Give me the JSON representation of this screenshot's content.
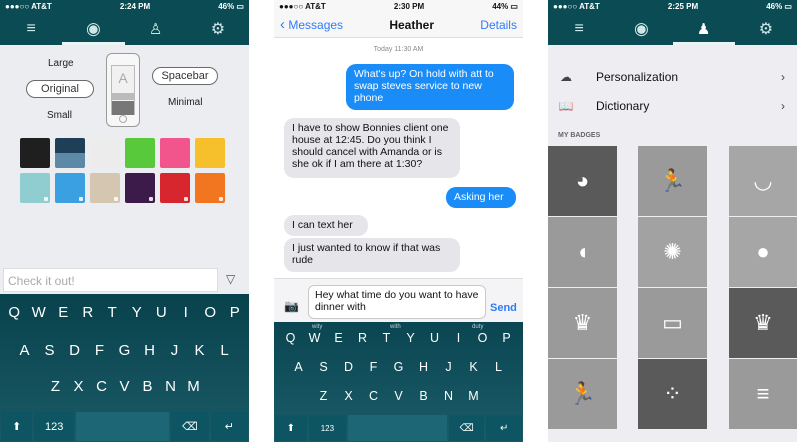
{
  "phone1": {
    "status": {
      "carrier": "●●●○○ AT&T ",
      "time": "2:24 PM",
      "battery": "46% ▭"
    },
    "tabs": [
      {
        "icon": "menu-icon",
        "glyph": "≡"
      },
      {
        "icon": "theme-icon",
        "glyph": "◉"
      },
      {
        "icon": "person-icon",
        "glyph": "♙"
      },
      {
        "icon": "gear-icon",
        "glyph": "⚙"
      }
    ],
    "size_options": {
      "large": "Large",
      "original": "Original",
      "small": "Small",
      "spacebar": "Spacebar",
      "minimal": "Minimal",
      "preview_letter": "A"
    },
    "swatches": [
      {
        "color": "#1f1f1f",
        "locked": false
      },
      {
        "color": "#1e3f57",
        "locked": false
      },
      {
        "color": "#ececec",
        "locked": false
      },
      {
        "color": "#58c93a",
        "locked": false
      },
      {
        "color": "#f2548c",
        "locked": false
      },
      {
        "color": "#f6c02d",
        "locked": false
      },
      {
        "color": "#8fcdd1",
        "locked": true
      },
      {
        "color": "#3aa0e2",
        "locked": true
      },
      {
        "color": "#d4c6b1",
        "locked": true
      },
      {
        "color": "#3c1a4a",
        "locked": true
      },
      {
        "color": "#d7262e",
        "locked": true
      },
      {
        "color": "#f2761f",
        "locked": true
      }
    ],
    "test_input_placeholder": "Check it out!",
    "keyboard": {
      "row1": [
        "Q",
        "W",
        "E",
        "R",
        "T",
        "Y",
        "U",
        "I",
        "O",
        "P"
      ],
      "row2": [
        "A",
        "S",
        "D",
        "F",
        "G",
        "H",
        "J",
        "K",
        "L"
      ],
      "row3": [
        "Z",
        "X",
        "C",
        "V",
        "B",
        "N",
        "M"
      ],
      "shift": "⬆",
      "numbers": "123",
      "delete": "⌫",
      "return": "↵"
    }
  },
  "phone2": {
    "status": {
      "carrier": "●●●○○ AT&T ",
      "time": "2:30 PM",
      "battery": "44% ▭"
    },
    "nav": {
      "back": "Messages",
      "title": "Heather",
      "details": "Details"
    },
    "timestamp": "Today 11:30 AM",
    "messages": [
      {
        "from": "me",
        "text": "What's up? On hold with att to swap steves service to new phone"
      },
      {
        "from": "them",
        "text": "I have to show Bonnies client one house at 12:45. Do you think I should cancel with Amanda or is she ok if I am there at 1:30?"
      },
      {
        "from": "me",
        "text": "Asking her"
      },
      {
        "from": "them",
        "text": "I can text her"
      },
      {
        "from": "them",
        "text": "I just wanted to know if that was rude"
      }
    ],
    "composer": {
      "text": "Hey what time do you want to have dinner with",
      "send": "Send"
    },
    "suggestions": [
      "wity",
      "with",
      "duty"
    ],
    "keyboard": {
      "row1": [
        "Q",
        "W",
        "E",
        "R",
        "T",
        "Y",
        "U",
        "I",
        "O",
        "P"
      ],
      "row2": [
        "A",
        "S",
        "D",
        "F",
        "G",
        "H",
        "J",
        "K",
        "L"
      ],
      "row3": [
        "Z",
        "X",
        "C",
        "V",
        "B",
        "N",
        "M"
      ],
      "shift": "⬆",
      "numbers": "123",
      "delete": "⌫",
      "return": "↵"
    }
  },
  "phone3": {
    "status": {
      "carrier": "●●●○○ AT&T ",
      "time": "2:25 PM",
      "battery": "46% ▭"
    },
    "menu": [
      {
        "label": "Personalization",
        "icon": "cloud-icon"
      },
      {
        "label": "Dictionary",
        "icon": "book-icon"
      }
    ],
    "badges_header": "MY BADGES",
    "badges": [
      {
        "icon": "globe-icon",
        "glyph": "◕",
        "shade": "#5a5a5a"
      },
      {
        "icon": "runner-icon",
        "glyph": "🏃",
        "shade": "#9a9a9a"
      },
      {
        "icon": "smile-icon",
        "glyph": "◡",
        "shade": "#a6a6a6"
      },
      {
        "icon": "bird-icon",
        "glyph": "◖",
        "shade": "#9a9a9a"
      },
      {
        "icon": "sun-icon",
        "glyph": "✺",
        "shade": "#a2a2a2"
      },
      {
        "icon": "person-icon",
        "glyph": "●",
        "shade": "#a6a6a6"
      },
      {
        "icon": "crown-icon",
        "glyph": "♛",
        "shade": "#9a9a9a"
      },
      {
        "icon": "book-icon",
        "glyph": "▭",
        "shade": "#9a9a9a"
      },
      {
        "icon": "crown-icon",
        "glyph": "♛",
        "shade": "#5a5a5a"
      },
      {
        "icon": "runner-icon",
        "glyph": "🏃",
        "shade": "#9a9a9a"
      },
      {
        "icon": "dots-circle-icon",
        "glyph": "⁘",
        "shade": "#5a5a5a"
      },
      {
        "icon": "bars-icon",
        "glyph": "≡",
        "shade": "#9a9a9a"
      }
    ]
  }
}
